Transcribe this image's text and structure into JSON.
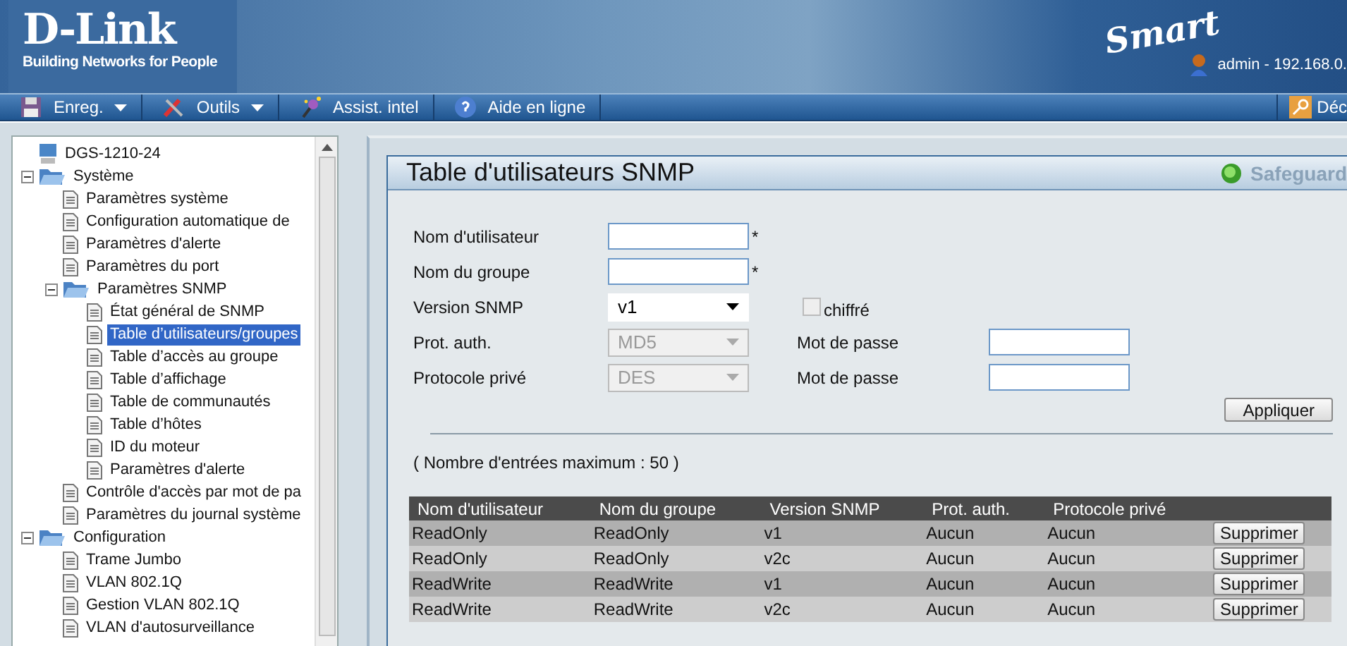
{
  "header": {
    "logo": "D-Link",
    "tagline": "Building Networks for People",
    "product": "Smart",
    "user": "admin - 192.168.0."
  },
  "menu": [
    {
      "label": "Enreg.",
      "kind": "save",
      "dropdown": true
    },
    {
      "label": "Outils",
      "kind": "tools",
      "dropdown": true
    },
    {
      "label": "Assist. intel",
      "kind": "wand",
      "dropdown": false
    },
    {
      "label": "Aide en ligne",
      "kind": "help",
      "dropdown": false
    }
  ],
  "logout": {
    "label": "Déc"
  },
  "tree": [
    {
      "label": "DGS-1210-24",
      "kind": "device",
      "selected": false
    },
    {
      "label": "Système",
      "kind": "folder",
      "expanded": true,
      "selected": false,
      "children": [
        {
          "label": "Paramètres système",
          "kind": "page",
          "selected": false
        },
        {
          "label": "Configuration automatique de",
          "kind": "page",
          "selected": false
        },
        {
          "label": "Paramètres d'alerte",
          "kind": "page",
          "selected": false
        },
        {
          "label": "Paramètres du port",
          "kind": "page",
          "selected": false
        },
        {
          "label": "Paramètres SNMP",
          "kind": "folder",
          "expanded": true,
          "selected": false,
          "children": [
            {
              "label": "État général de SNMP",
              "kind": "page",
              "selected": false
            },
            {
              "label": "Table d’utilisateurs/groupes",
              "kind": "page",
              "selected": true
            },
            {
              "label": "Table d’accès au groupe",
              "kind": "page",
              "selected": false
            },
            {
              "label": "Table d’affichage",
              "kind": "page",
              "selected": false
            },
            {
              "label": "Table de communautés",
              "kind": "page",
              "selected": false
            },
            {
              "label": "Table d’hôtes",
              "kind": "page",
              "selected": false
            },
            {
              "label": "ID du moteur",
              "kind": "page",
              "selected": false
            },
            {
              "label": "Paramètres d'alerte",
              "kind": "page",
              "selected": false
            }
          ]
        },
        {
          "label": "Contrôle d'accès par mot de pa",
          "kind": "page",
          "selected": false
        },
        {
          "label": "Paramètres du journal système",
          "kind": "page",
          "selected": false
        }
      ]
    },
    {
      "label": "Configuration",
      "kind": "folder",
      "expanded": true,
      "selected": false,
      "children": [
        {
          "label": "Trame Jumbo",
          "kind": "page",
          "selected": false
        },
        {
          "label": "VLAN 802.1Q",
          "kind": "page",
          "selected": false
        },
        {
          "label": "Gestion VLAN 802.1Q",
          "kind": "page",
          "selected": false
        },
        {
          "label": "VLAN d'autosurveillance",
          "kind": "page",
          "selected": false
        }
      ]
    }
  ],
  "panel": {
    "title": "Table d'utilisateurs SNMP",
    "safeguard": "Safeguard",
    "form": [
      {
        "label": "Nom d'utilisateur",
        "control": {
          "kind": "text",
          "required": "*"
        }
      },
      {
        "label": "Nom du groupe",
        "control": {
          "kind": "text",
          "required": "*"
        }
      },
      {
        "label": "Version SNMP",
        "control": {
          "kind": "select",
          "value": "v1",
          "disabled": false
        },
        "extra": {
          "kind": "checkbox",
          "label": "chiffré",
          "checked": false,
          "disabled": true
        }
      },
      {
        "label": "Prot. auth.",
        "control": {
          "kind": "select",
          "value": "MD5",
          "disabled": true
        },
        "extra": {
          "kind": "password",
          "label": "Mot de passe"
        }
      },
      {
        "label": "Protocole privé",
        "control": {
          "kind": "select",
          "value": "DES",
          "disabled": true
        },
        "extra": {
          "kind": "password",
          "label": "Mot de passe"
        }
      }
    ],
    "apply": "Appliquer",
    "count": "( Nombre d'entrées maximum : 50 )",
    "table": {
      "columns": [
        "Nom d'utilisateur",
        "Nom du groupe",
        "Version SNMP",
        "Prot. auth.",
        "Protocole privé"
      ],
      "rows": [
        {
          "cells": [
            "ReadOnly",
            "ReadOnly",
            "v1",
            "Aucun",
            "Aucun"
          ],
          "action": "Supprimer"
        },
        {
          "cells": [
            "ReadOnly",
            "ReadOnly",
            "v2c",
            "Aucun",
            "Aucun"
          ],
          "action": "Supprimer"
        },
        {
          "cells": [
            "ReadWrite",
            "ReadWrite",
            "v1",
            "Aucun",
            "Aucun"
          ],
          "action": "Supprimer"
        },
        {
          "cells": [
            "ReadWrite",
            "ReadWrite",
            "v2c",
            "Aucun",
            "Aucun"
          ],
          "action": "Supprimer"
        }
      ]
    }
  }
}
